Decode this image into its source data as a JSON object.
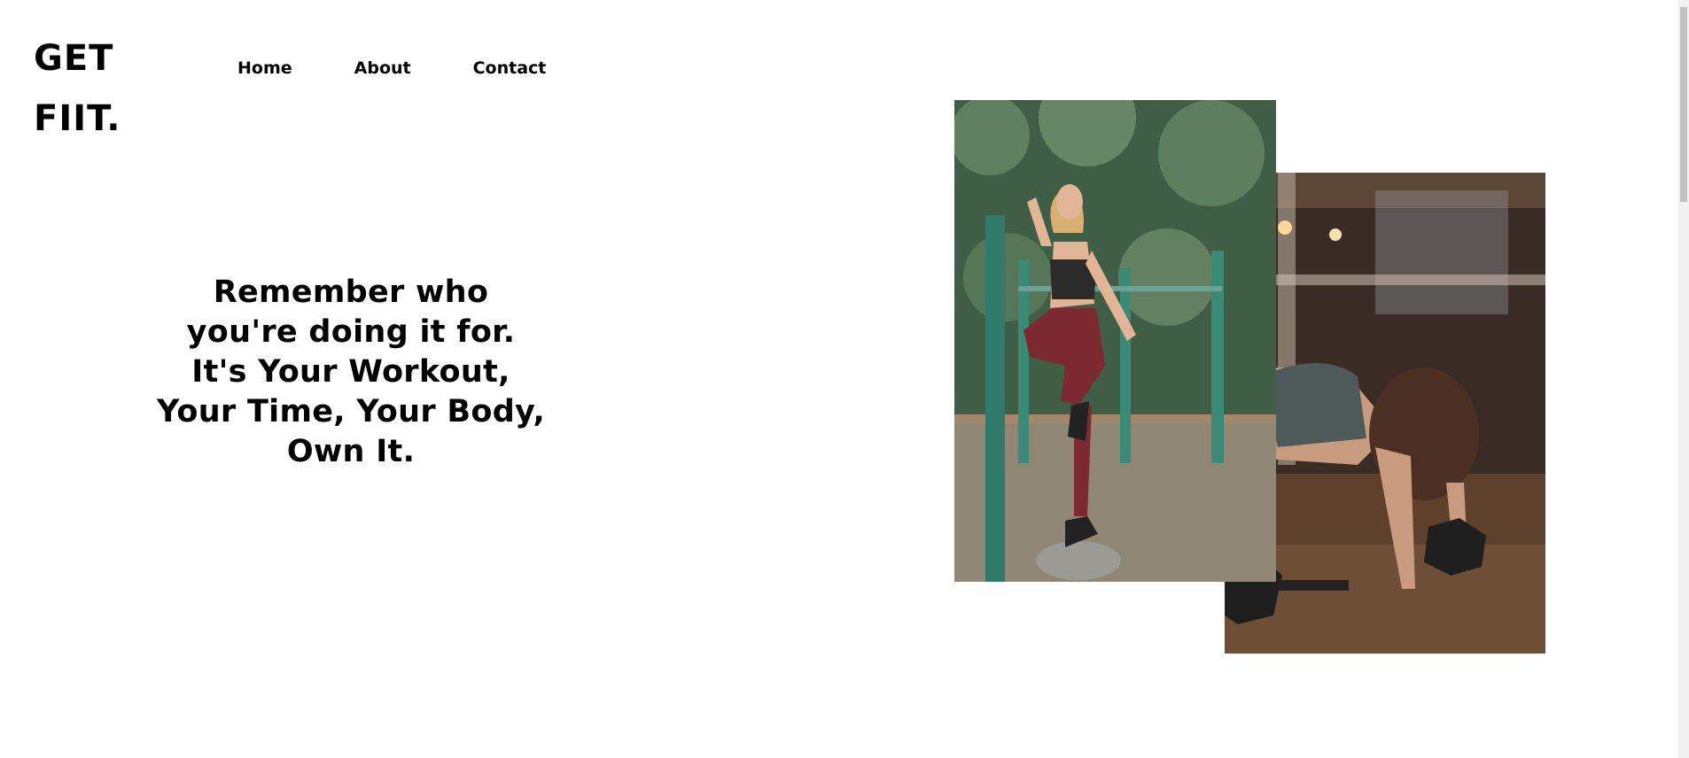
{
  "brand": {
    "line1": "GET",
    "line2": "FIIT."
  },
  "nav": {
    "items": [
      "Home",
      "About",
      "Contact"
    ]
  },
  "hero": {
    "headline": "Remember who you're doing it for. It's Your Workout, Your Time, Your Body, Own It."
  },
  "images": {
    "front": "woman-step-up-outdoor-photo",
    "back": "woman-dumbbell-plank-gym-photo"
  },
  "colors": {
    "background": "#ffffff",
    "text": "#000000",
    "scrollbar_track": "#f1f1f1",
    "scrollbar_thumb": "#c1c1c1"
  }
}
